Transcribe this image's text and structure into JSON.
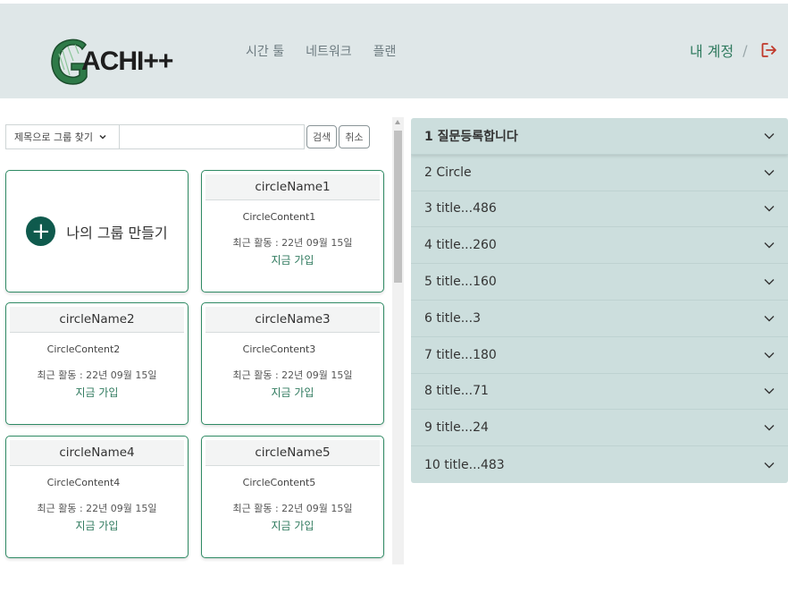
{
  "header": {
    "logo_text": "ACHI++",
    "nav": [
      "시간 툴",
      "네트워크",
      "플랜"
    ],
    "account_label": "내 계정",
    "separator": "/"
  },
  "search": {
    "select_value": "제목으로 그룹 찾기",
    "input_value": "",
    "search_button": "검색",
    "cancel_button": "취소"
  },
  "create_card": {
    "label": "나의 그룹 만들기",
    "icon": "plus-icon"
  },
  "circles": [
    {
      "name": "circleName1",
      "content": "CircleContent1",
      "activity": "최근 활동 : 22년 09월 15일",
      "join": "지금 가입"
    },
    {
      "name": "circleName2",
      "content": "CircleContent2",
      "activity": "최근 활동 : 22년 09월 15일",
      "join": "지금 가입"
    },
    {
      "name": "circleName3",
      "content": "CircleContent3",
      "activity": "최근 활동 : 22년 09월 15일",
      "join": "지금 가입"
    },
    {
      "name": "circleName4",
      "content": "CircleContent4",
      "activity": "최근 활동 : 22년 09월 15일",
      "join": "지금 가입"
    },
    {
      "name": "circleName5",
      "content": "CircleContent5",
      "activity": "최근 활동 : 22년 09월 15일",
      "join": "지금 가입"
    }
  ],
  "accordion": [
    "1 질문등록합니다",
    "2 Circle",
    "3 title...486",
    "4 title...260",
    "5 title...160",
    "6 title...3",
    "7 title...180",
    "8 title...71",
    "9 title...24",
    "10 title...483"
  ],
  "colors": {
    "accent": "#2f7a5e",
    "header_bg": "#dfe7e8",
    "accordion_bg": "#ccdedd",
    "plus_bg": "#0f5a4d"
  }
}
